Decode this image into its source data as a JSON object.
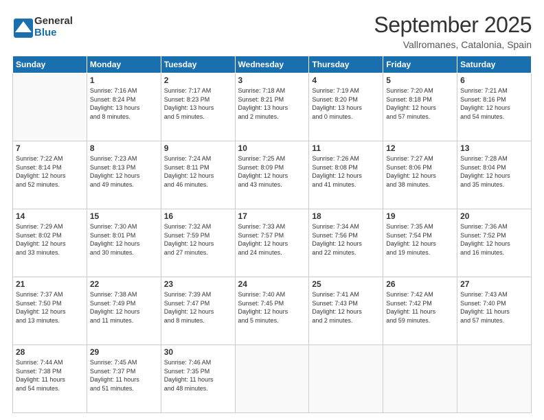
{
  "logo": {
    "line1": "General",
    "line2": "Blue"
  },
  "title": "September 2025",
  "subtitle": "Vallromanes, Catalonia, Spain",
  "days_header": [
    "Sunday",
    "Monday",
    "Tuesday",
    "Wednesday",
    "Thursday",
    "Friday",
    "Saturday"
  ],
  "weeks": [
    [
      {
        "day": "",
        "info": ""
      },
      {
        "day": "1",
        "info": "Sunrise: 7:16 AM\nSunset: 8:24 PM\nDaylight: 13 hours\nand 8 minutes."
      },
      {
        "day": "2",
        "info": "Sunrise: 7:17 AM\nSunset: 8:23 PM\nDaylight: 13 hours\nand 5 minutes."
      },
      {
        "day": "3",
        "info": "Sunrise: 7:18 AM\nSunset: 8:21 PM\nDaylight: 13 hours\nand 2 minutes."
      },
      {
        "day": "4",
        "info": "Sunrise: 7:19 AM\nSunset: 8:20 PM\nDaylight: 13 hours\nand 0 minutes."
      },
      {
        "day": "5",
        "info": "Sunrise: 7:20 AM\nSunset: 8:18 PM\nDaylight: 12 hours\nand 57 minutes."
      },
      {
        "day": "6",
        "info": "Sunrise: 7:21 AM\nSunset: 8:16 PM\nDaylight: 12 hours\nand 54 minutes."
      }
    ],
    [
      {
        "day": "7",
        "info": "Sunrise: 7:22 AM\nSunset: 8:14 PM\nDaylight: 12 hours\nand 52 minutes."
      },
      {
        "day": "8",
        "info": "Sunrise: 7:23 AM\nSunset: 8:13 PM\nDaylight: 12 hours\nand 49 minutes."
      },
      {
        "day": "9",
        "info": "Sunrise: 7:24 AM\nSunset: 8:11 PM\nDaylight: 12 hours\nand 46 minutes."
      },
      {
        "day": "10",
        "info": "Sunrise: 7:25 AM\nSunset: 8:09 PM\nDaylight: 12 hours\nand 43 minutes."
      },
      {
        "day": "11",
        "info": "Sunrise: 7:26 AM\nSunset: 8:08 PM\nDaylight: 12 hours\nand 41 minutes."
      },
      {
        "day": "12",
        "info": "Sunrise: 7:27 AM\nSunset: 8:06 PM\nDaylight: 12 hours\nand 38 minutes."
      },
      {
        "day": "13",
        "info": "Sunrise: 7:28 AM\nSunset: 8:04 PM\nDaylight: 12 hours\nand 35 minutes."
      }
    ],
    [
      {
        "day": "14",
        "info": "Sunrise: 7:29 AM\nSunset: 8:02 PM\nDaylight: 12 hours\nand 33 minutes."
      },
      {
        "day": "15",
        "info": "Sunrise: 7:30 AM\nSunset: 8:01 PM\nDaylight: 12 hours\nand 30 minutes."
      },
      {
        "day": "16",
        "info": "Sunrise: 7:32 AM\nSunset: 7:59 PM\nDaylight: 12 hours\nand 27 minutes."
      },
      {
        "day": "17",
        "info": "Sunrise: 7:33 AM\nSunset: 7:57 PM\nDaylight: 12 hours\nand 24 minutes."
      },
      {
        "day": "18",
        "info": "Sunrise: 7:34 AM\nSunset: 7:56 PM\nDaylight: 12 hours\nand 22 minutes."
      },
      {
        "day": "19",
        "info": "Sunrise: 7:35 AM\nSunset: 7:54 PM\nDaylight: 12 hours\nand 19 minutes."
      },
      {
        "day": "20",
        "info": "Sunrise: 7:36 AM\nSunset: 7:52 PM\nDaylight: 12 hours\nand 16 minutes."
      }
    ],
    [
      {
        "day": "21",
        "info": "Sunrise: 7:37 AM\nSunset: 7:50 PM\nDaylight: 12 hours\nand 13 minutes."
      },
      {
        "day": "22",
        "info": "Sunrise: 7:38 AM\nSunset: 7:49 PM\nDaylight: 12 hours\nand 11 minutes."
      },
      {
        "day": "23",
        "info": "Sunrise: 7:39 AM\nSunset: 7:47 PM\nDaylight: 12 hours\nand 8 minutes."
      },
      {
        "day": "24",
        "info": "Sunrise: 7:40 AM\nSunset: 7:45 PM\nDaylight: 12 hours\nand 5 minutes."
      },
      {
        "day": "25",
        "info": "Sunrise: 7:41 AM\nSunset: 7:43 PM\nDaylight: 12 hours\nand 2 minutes."
      },
      {
        "day": "26",
        "info": "Sunrise: 7:42 AM\nSunset: 7:42 PM\nDaylight: 11 hours\nand 59 minutes."
      },
      {
        "day": "27",
        "info": "Sunrise: 7:43 AM\nSunset: 7:40 PM\nDaylight: 11 hours\nand 57 minutes."
      }
    ],
    [
      {
        "day": "28",
        "info": "Sunrise: 7:44 AM\nSunset: 7:38 PM\nDaylight: 11 hours\nand 54 minutes."
      },
      {
        "day": "29",
        "info": "Sunrise: 7:45 AM\nSunset: 7:37 PM\nDaylight: 11 hours\nand 51 minutes."
      },
      {
        "day": "30",
        "info": "Sunrise: 7:46 AM\nSunset: 7:35 PM\nDaylight: 11 hours\nand 48 minutes."
      },
      {
        "day": "",
        "info": ""
      },
      {
        "day": "",
        "info": ""
      },
      {
        "day": "",
        "info": ""
      },
      {
        "day": "",
        "info": ""
      }
    ]
  ]
}
